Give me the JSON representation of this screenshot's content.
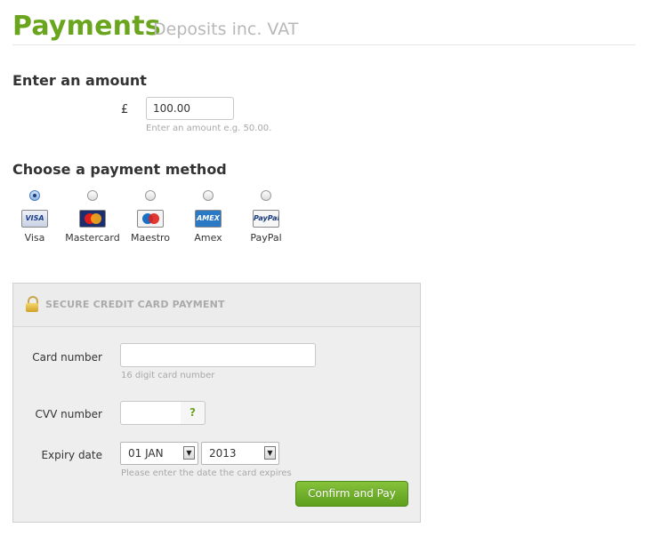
{
  "header": {
    "title": "Payments",
    "subtitle": "Deposits inc. VAT"
  },
  "amount": {
    "heading": "Enter an amount",
    "currency_symbol": "£",
    "value": "100.00",
    "hint": "Enter an amount e.g. 50.00."
  },
  "payment_method": {
    "heading": "Choose a payment method",
    "selected": "Visa",
    "options": [
      {
        "label": "Visa",
        "icon": "visa-card-icon",
        "icon_text": "VISA",
        "checked": true
      },
      {
        "label": "Mastercard",
        "icon": "mastercard-icon",
        "icon_text": "",
        "checked": false
      },
      {
        "label": "Maestro",
        "icon": "maestro-icon",
        "icon_text": "",
        "checked": false
      },
      {
        "label": "Amex",
        "icon": "amex-icon",
        "icon_text": "AMEX",
        "checked": false
      },
      {
        "label": "PayPal",
        "icon": "paypal-icon",
        "icon_text": "PayPal",
        "checked": false
      }
    ]
  },
  "secure_panel": {
    "title": "SECURE CREDIT CARD PAYMENT",
    "icon": "lock-icon",
    "card_number": {
      "label": "Card number",
      "value": "",
      "hint": "16 digit card number"
    },
    "cvv": {
      "label": "CVV number",
      "value": "",
      "help_label": "?"
    },
    "expiry": {
      "label": "Expiry date",
      "month": "01 JAN",
      "year": "2013",
      "hint": "Please enter the date the card expires"
    },
    "confirm_label": "Confirm and Pay"
  },
  "colors": {
    "brand_green": "#6aa51e",
    "button_green": "#5e9f1e",
    "muted_text": "#a8a8a8"
  }
}
